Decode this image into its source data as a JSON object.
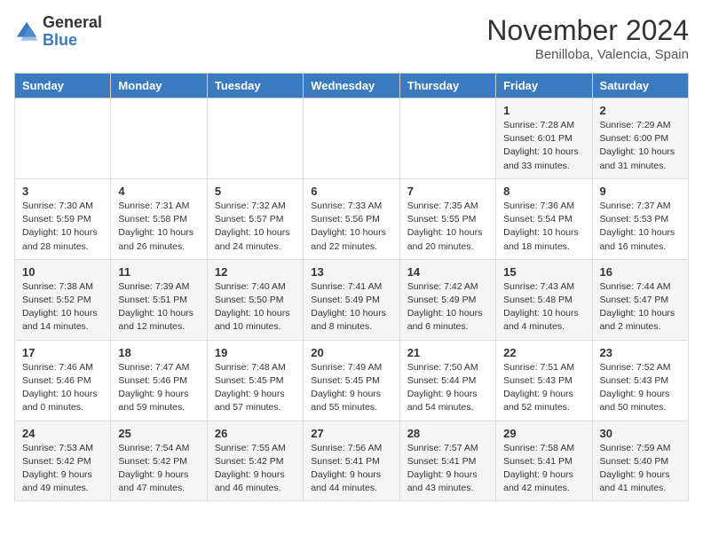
{
  "header": {
    "logo": {
      "line1": "General",
      "line2": "Blue"
    },
    "month": "November 2024",
    "location": "Benilloba, Valencia, Spain"
  },
  "weekdays": [
    "Sunday",
    "Monday",
    "Tuesday",
    "Wednesday",
    "Thursday",
    "Friday",
    "Saturday"
  ],
  "weeks": [
    [
      {
        "day": "",
        "info": ""
      },
      {
        "day": "",
        "info": ""
      },
      {
        "day": "",
        "info": ""
      },
      {
        "day": "",
        "info": ""
      },
      {
        "day": "",
        "info": ""
      },
      {
        "day": "1",
        "info": "Sunrise: 7:28 AM\nSunset: 6:01 PM\nDaylight: 10 hours and 33 minutes."
      },
      {
        "day": "2",
        "info": "Sunrise: 7:29 AM\nSunset: 6:00 PM\nDaylight: 10 hours and 31 minutes."
      }
    ],
    [
      {
        "day": "3",
        "info": "Sunrise: 7:30 AM\nSunset: 5:59 PM\nDaylight: 10 hours and 28 minutes."
      },
      {
        "day": "4",
        "info": "Sunrise: 7:31 AM\nSunset: 5:58 PM\nDaylight: 10 hours and 26 minutes."
      },
      {
        "day": "5",
        "info": "Sunrise: 7:32 AM\nSunset: 5:57 PM\nDaylight: 10 hours and 24 minutes."
      },
      {
        "day": "6",
        "info": "Sunrise: 7:33 AM\nSunset: 5:56 PM\nDaylight: 10 hours and 22 minutes."
      },
      {
        "day": "7",
        "info": "Sunrise: 7:35 AM\nSunset: 5:55 PM\nDaylight: 10 hours and 20 minutes."
      },
      {
        "day": "8",
        "info": "Sunrise: 7:36 AM\nSunset: 5:54 PM\nDaylight: 10 hours and 18 minutes."
      },
      {
        "day": "9",
        "info": "Sunrise: 7:37 AM\nSunset: 5:53 PM\nDaylight: 10 hours and 16 minutes."
      }
    ],
    [
      {
        "day": "10",
        "info": "Sunrise: 7:38 AM\nSunset: 5:52 PM\nDaylight: 10 hours and 14 minutes."
      },
      {
        "day": "11",
        "info": "Sunrise: 7:39 AM\nSunset: 5:51 PM\nDaylight: 10 hours and 12 minutes."
      },
      {
        "day": "12",
        "info": "Sunrise: 7:40 AM\nSunset: 5:50 PM\nDaylight: 10 hours and 10 minutes."
      },
      {
        "day": "13",
        "info": "Sunrise: 7:41 AM\nSunset: 5:49 PM\nDaylight: 10 hours and 8 minutes."
      },
      {
        "day": "14",
        "info": "Sunrise: 7:42 AM\nSunset: 5:49 PM\nDaylight: 10 hours and 6 minutes."
      },
      {
        "day": "15",
        "info": "Sunrise: 7:43 AM\nSunset: 5:48 PM\nDaylight: 10 hours and 4 minutes."
      },
      {
        "day": "16",
        "info": "Sunrise: 7:44 AM\nSunset: 5:47 PM\nDaylight: 10 hours and 2 minutes."
      }
    ],
    [
      {
        "day": "17",
        "info": "Sunrise: 7:46 AM\nSunset: 5:46 PM\nDaylight: 10 hours and 0 minutes."
      },
      {
        "day": "18",
        "info": "Sunrise: 7:47 AM\nSunset: 5:46 PM\nDaylight: 9 hours and 59 minutes."
      },
      {
        "day": "19",
        "info": "Sunrise: 7:48 AM\nSunset: 5:45 PM\nDaylight: 9 hours and 57 minutes."
      },
      {
        "day": "20",
        "info": "Sunrise: 7:49 AM\nSunset: 5:45 PM\nDaylight: 9 hours and 55 minutes."
      },
      {
        "day": "21",
        "info": "Sunrise: 7:50 AM\nSunset: 5:44 PM\nDaylight: 9 hours and 54 minutes."
      },
      {
        "day": "22",
        "info": "Sunrise: 7:51 AM\nSunset: 5:43 PM\nDaylight: 9 hours and 52 minutes."
      },
      {
        "day": "23",
        "info": "Sunrise: 7:52 AM\nSunset: 5:43 PM\nDaylight: 9 hours and 50 minutes."
      }
    ],
    [
      {
        "day": "24",
        "info": "Sunrise: 7:53 AM\nSunset: 5:42 PM\nDaylight: 9 hours and 49 minutes."
      },
      {
        "day": "25",
        "info": "Sunrise: 7:54 AM\nSunset: 5:42 PM\nDaylight: 9 hours and 47 minutes."
      },
      {
        "day": "26",
        "info": "Sunrise: 7:55 AM\nSunset: 5:42 PM\nDaylight: 9 hours and 46 minutes."
      },
      {
        "day": "27",
        "info": "Sunrise: 7:56 AM\nSunset: 5:41 PM\nDaylight: 9 hours and 44 minutes."
      },
      {
        "day": "28",
        "info": "Sunrise: 7:57 AM\nSunset: 5:41 PM\nDaylight: 9 hours and 43 minutes."
      },
      {
        "day": "29",
        "info": "Sunrise: 7:58 AM\nSunset: 5:41 PM\nDaylight: 9 hours and 42 minutes."
      },
      {
        "day": "30",
        "info": "Sunrise: 7:59 AM\nSunset: 5:40 PM\nDaylight: 9 hours and 41 minutes."
      }
    ]
  ]
}
